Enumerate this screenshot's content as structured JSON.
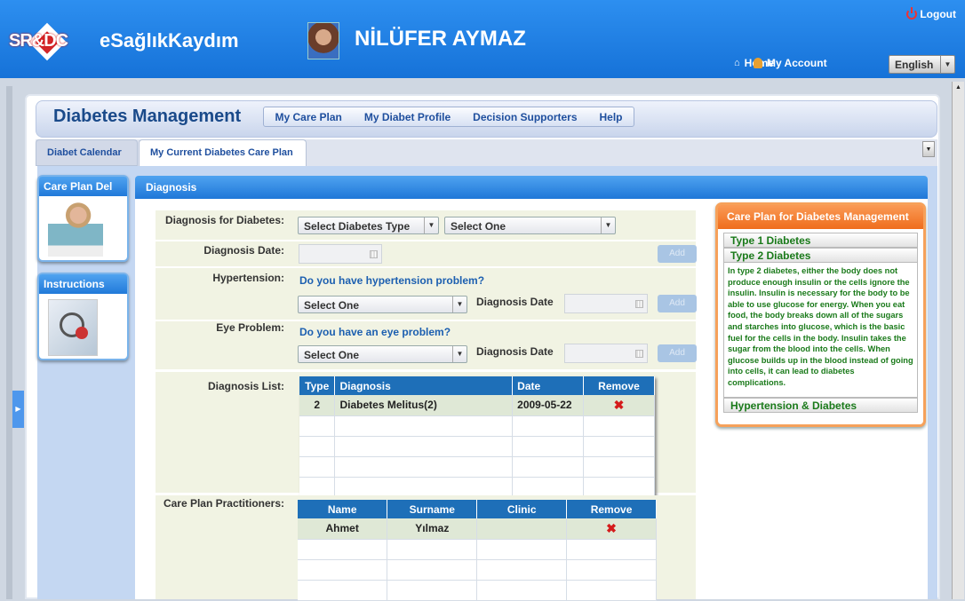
{
  "header": {
    "logo_text": "SR&DC",
    "app_name": "eSağlıkKaydım",
    "user_name": "NİLÜFER AYMAZ",
    "logout": "Logout",
    "home": "Home",
    "account": "My Account",
    "language": "English"
  },
  "page": {
    "title": "Diabetes Management",
    "menu": [
      "My Care Plan",
      "My Diabet Profile",
      "Decision Supporters",
      "Help"
    ]
  },
  "tabs": [
    "Diabet Calendar",
    "My Current Diabetes Care Plan"
  ],
  "side": {
    "box1": "Care Plan Del",
    "box2": "Instructions"
  },
  "diagnosis": {
    "header": "Diagnosis",
    "diabetes_label": "Diagnosis for Diabetes:",
    "diabetes_type": "Select Diabetes Type",
    "diabetes_select": "Select One",
    "date_label": "Diagnosis Date:",
    "add": "Add",
    "hyper_label": "Hypertension:",
    "hyper_q": "Do you have hypertension problem?",
    "hyper_select": "Select One",
    "eye_label": "Eye Problem:",
    "eye_q": "Do you have an eye problem?",
    "eye_select": "Select One",
    "diag_date": "Diagnosis Date",
    "list_label": "Diagnosis List:",
    "list_cols": [
      "Type",
      "Diagnosis",
      "Date",
      "Remove"
    ],
    "list_rows": [
      {
        "type": "2",
        "diagnosis": "Diabetes Melitus(2)",
        "date": "2009-05-22"
      }
    ],
    "prac_label": "Care Plan Practitioners:",
    "prac_cols": [
      "Name",
      "Surname",
      "Clinic",
      "Remove"
    ],
    "prac_rows": [
      {
        "name": "Ahmet",
        "surname": "Yılmaz",
        "clinic": ""
      }
    ]
  },
  "careplan": {
    "title": "Care Plan for Diabetes Management",
    "sections": [
      "Type 1 Diabetes",
      "Type 2 Diabetes",
      "Hypertension & Diabetes"
    ],
    "text": "In type 2 diabetes, either the body does not produce enough insulin or the cells ignore the insulin. Insulin is necessary for the body to be able to use glucose for energy. When you eat food, the body breaks down all of the sugars and starches into glucose, which is the basic fuel for the cells in the body. Insulin takes the sugar from the blood into the cells. When glucose builds up in the blood instead of going into cells, it can lead to diabetes complications."
  },
  "colors": {
    "header": "#1f80e8",
    "accent_orange": "#f07a2a",
    "table_header": "#1e6fb8",
    "text_green": "#1a7a1a"
  }
}
